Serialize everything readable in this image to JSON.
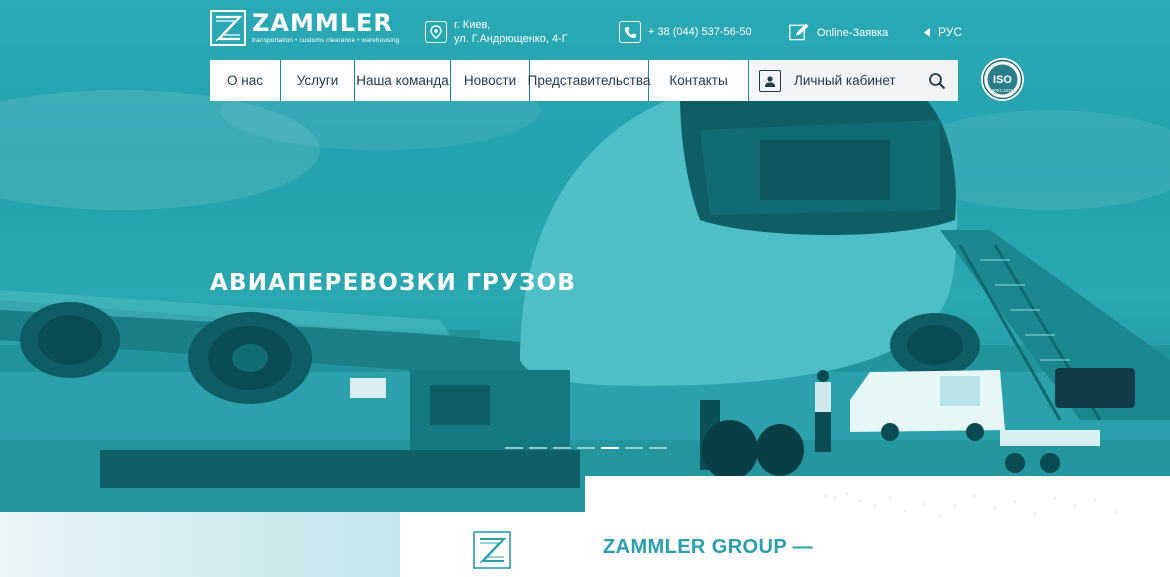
{
  "brand": {
    "name": "ZAMMLER",
    "tagline": "transportation • customs clearance • warehousing"
  },
  "header": {
    "address_line1": "г. Киев,",
    "address_line2": "ул. Г.Андрющенко, 4-Г",
    "phone": "+ 38 (044) 537-56-50",
    "online_request": "Online-Заявка",
    "language": "РУС"
  },
  "nav": {
    "items": [
      {
        "label": "О нас"
      },
      {
        "label": "Услуги"
      },
      {
        "label": "Наша команда"
      },
      {
        "label": "Новости"
      },
      {
        "label": "Представительства"
      },
      {
        "label": "Контакты"
      }
    ],
    "cabinet_label": "Личный кабинет"
  },
  "iso": {
    "label": "ISO",
    "standard": "9001:2015"
  },
  "hero": {
    "title": "АВИАПЕРЕВОЗКИ ГРУЗОВ",
    "slide_count": 7,
    "active_slide": 5
  },
  "about": {
    "title": "ZAMMLER GROUP —"
  },
  "colors": {
    "teal_overlay": "#2aa7b0",
    "nav_text": "#1d3a4c",
    "accent": "#2a9fb0"
  }
}
